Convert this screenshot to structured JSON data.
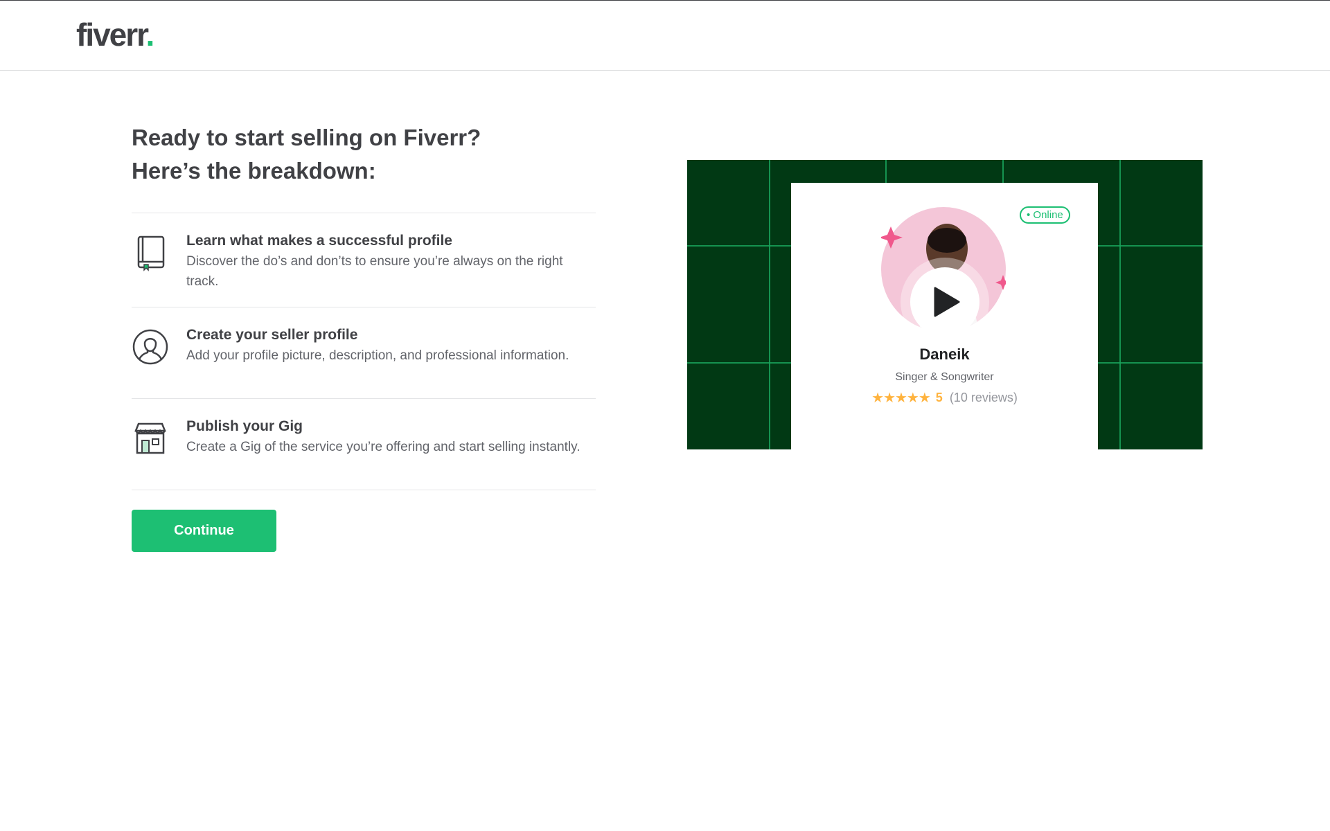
{
  "brand": {
    "logo_text": "fiverr",
    "logo_dot": ".",
    "accent_color": "#1dbf73",
    "dark_green": "#013914"
  },
  "main": {
    "headline_line1": "Ready to start selling on Fiverr?",
    "headline_line2": "Here’s the breakdown:",
    "steps": [
      {
        "icon": "book-icon",
        "title": "Learn what makes a successful profile",
        "description": "Discover the do’s and don’ts to ensure you’re always on the right track."
      },
      {
        "icon": "user-profile-icon",
        "title": "Create your seller profile",
        "description": "Add your profile picture, description, and professional information."
      },
      {
        "icon": "store-icon",
        "title": "Publish your Gig",
        "description": "Create a Gig of the service you’re offering and start selling instantly."
      }
    ],
    "continue_label": "Continue"
  },
  "video_card": {
    "online_label": "• Online",
    "seller_name": "Daneik",
    "seller_role": "Singer & Songwriter",
    "stars": "★★★★★",
    "rating": "5",
    "reviews": "(10 reviews)",
    "play_icon": "play-icon"
  }
}
